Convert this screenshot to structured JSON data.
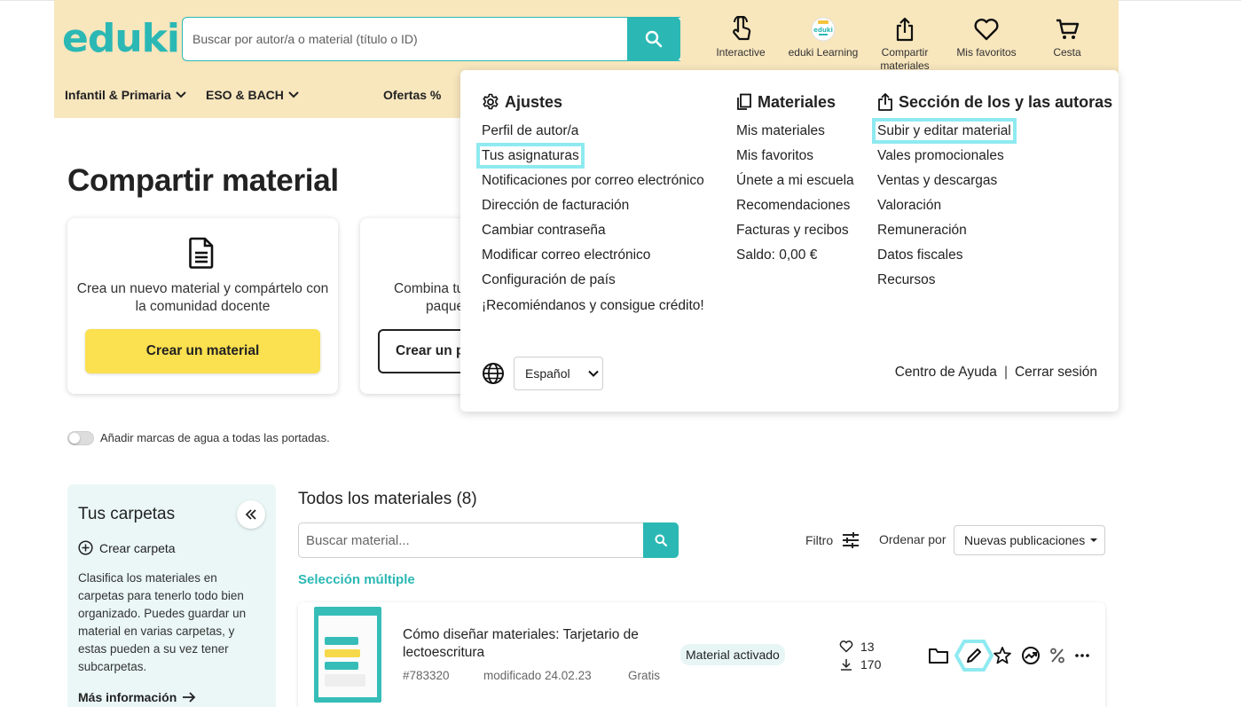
{
  "brand": {
    "logo": "eduki",
    "accent": "#2bb8b4",
    "header_bg": "#f8e6bd",
    "cta_yellow": "#fbe04f",
    "highlight": "#8eeaf0"
  },
  "header": {
    "search_placeholder": "Buscar por autor/a o material (título o ID)",
    "nav": [
      {
        "label": "Interactive",
        "icon": "touch-hand-icon"
      },
      {
        "label": "eduki Learning",
        "icon": "eduki-learning-icon"
      },
      {
        "label": "Compartir materiales",
        "icon": "share-upload-icon"
      },
      {
        "label": "Mis favoritos",
        "icon": "heart-icon"
      },
      {
        "label": "Cesta",
        "icon": "cart-icon"
      }
    ],
    "categories": [
      "Infantil & Primaria",
      "ESO & BACH",
      "Ofertas %"
    ]
  },
  "page": {
    "title": "Compartir material",
    "card1": {
      "text": "Crea un nuevo material y compártelo con la comunidad docente",
      "button": "Crear un material"
    },
    "card2": {
      "text_line1": "Combina tu",
      "text_line2": "paque",
      "button": "Crear un p"
    },
    "watermark_label": "Añadir marcas de agua a todas las portadas."
  },
  "folders": {
    "title": "Tus carpetas",
    "create": "Crear carpeta",
    "description": "Clasifica los materiales en carpetas para tenerlo todo bien organizado. Puedes guardar un material en varias carpetas, y estas pueden a su vez tener subcarpetas.",
    "more_info": "Más información"
  },
  "materials": {
    "title": "Todos los materiales (8)",
    "search_placeholder": "Buscar material...",
    "filter_label": "Filtro",
    "sort_label": "Ordenar por",
    "sort_value": "Nuevas publicaciones",
    "multi_select": "Selección múltiple",
    "items": [
      {
        "title": "Cómo diseñar materiales: Tarjetario de lectoescritura",
        "id": "#783320",
        "modified": "modificado 24.02.23",
        "price": "Gratis",
        "status": "Material activado",
        "likes": "13",
        "downloads": "170"
      }
    ]
  },
  "menu": {
    "settings": {
      "title": "Ajustes",
      "items": [
        "Perfil de autor/a",
        "Tus asignaturas",
        "Notificaciones por correo electrónico",
        "Dirección de facturación",
        "Cambiar contraseña",
        "Modificar correo electrónico",
        "Configuración de país",
        "¡Recomiéndanos y consigue crédito!"
      ]
    },
    "materials": {
      "title": "Materiales",
      "items": [
        "Mis materiales",
        "Mis favoritos",
        "Únete a mi escuela",
        "Recomendaciones",
        "Facturas y recibos",
        "Saldo: 0,00 €"
      ]
    },
    "authors": {
      "title": "Sección de los y las autoras",
      "items": [
        "Subir y editar material",
        "Vales promocionales",
        "Ventas y descargas",
        "Valoración",
        "Remuneración",
        "Datos fiscales",
        "Recursos"
      ]
    },
    "language": "Español",
    "help": "Centro de Ayuda",
    "separator": "|",
    "logout": "Cerrar sesión"
  }
}
